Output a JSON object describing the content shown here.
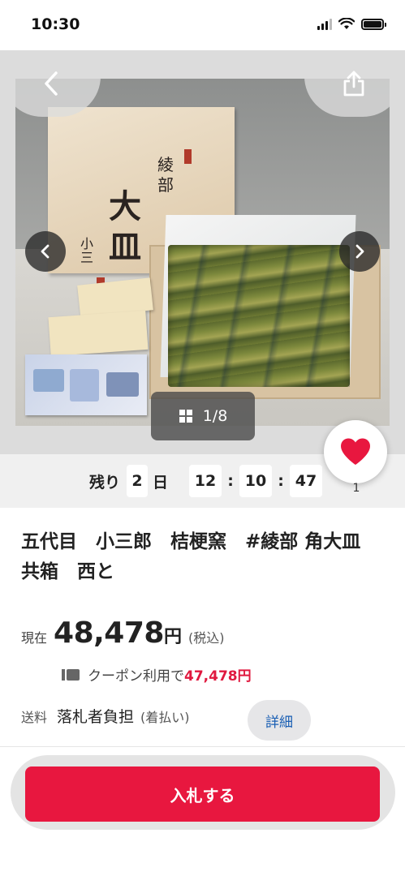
{
  "status_bar": {
    "time": "10:30"
  },
  "gallery": {
    "counter": "1/8"
  },
  "timer": {
    "label": "残り",
    "days": "2",
    "days_unit": "日",
    "hours": "12",
    "minutes": "10",
    "seconds": "47",
    "separator": ":"
  },
  "watch": {
    "count": "1"
  },
  "item": {
    "title": "五代目　小三郎　桔梗窯　#綾部 角大皿　共箱　西と",
    "price_label": "現在",
    "price_value": "48,478",
    "price_unit": "円",
    "tax_note": "(税込)",
    "coupon_text": "クーポン利用で",
    "coupon_price": "47,478円",
    "shipping_label": "送料",
    "shipping_value": "落札者負担",
    "shipping_note": "(着払い)",
    "detail_label": "詳細"
  },
  "actions": {
    "bid_label": "入札する"
  },
  "colors": {
    "accent": "#e8173f",
    "link": "#1a5fb4"
  }
}
